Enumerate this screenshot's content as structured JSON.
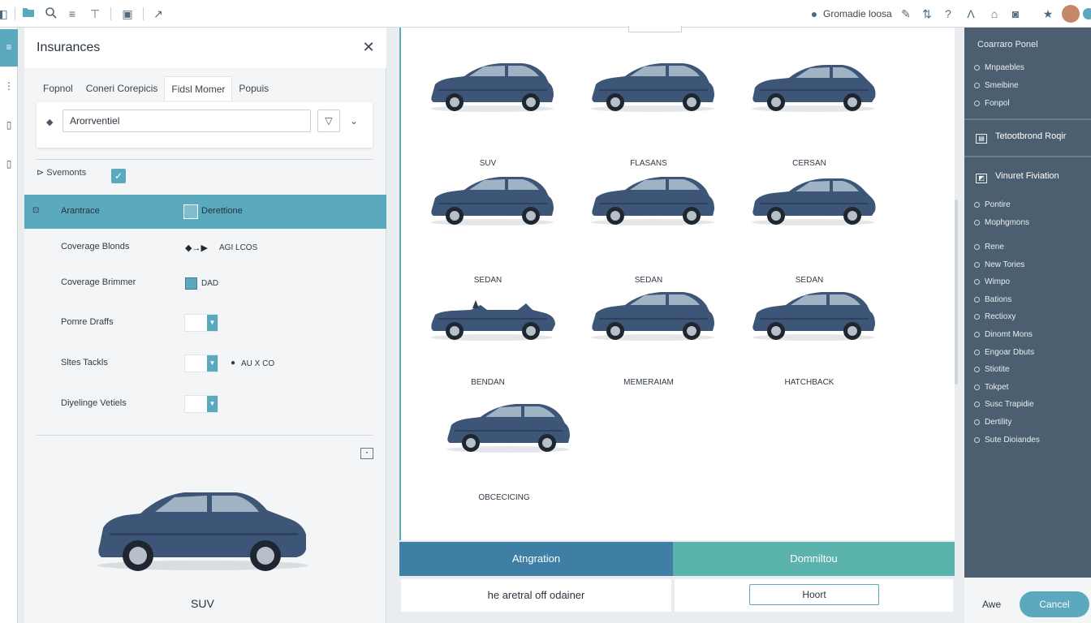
{
  "toolbar": {
    "location_label": "Gromadie loosa",
    "icons": [
      "folder-icon",
      "search-icon",
      "filter-icon",
      "text-icon",
      "image-icon",
      "arrow-icon",
      "globe-icon",
      "tools-icon",
      "help-icon",
      "font-icon",
      "print-icon",
      "camera-icon",
      "star-icon",
      "avatar",
      "settings-icon"
    ]
  },
  "panel": {
    "title": "Insurances",
    "tabs": [
      "Fopnol",
      "Coneri Corepicis",
      "Fidsl Momer",
      "Popuis"
    ],
    "active_tab": 2,
    "search": {
      "value": "Arorrventiel"
    },
    "section": {
      "label": "Svemonts",
      "checked": true
    },
    "highlight": {
      "mark": "⊡",
      "label": "Arantrace",
      "value": "Derettione"
    },
    "fields": [
      {
        "label": "Coverage Blonds",
        "value": "AGI LCOS",
        "control": "arrows"
      },
      {
        "label": "Coverage Brimmer",
        "value": "DAD",
        "control": "swatch"
      },
      {
        "label": "Pomre Draffs",
        "value": "",
        "control": "select"
      },
      {
        "label": "Sltes Tackls",
        "value": "AU X CO",
        "control": "select"
      },
      {
        "label": "Diyelinge Vetiels",
        "value": "",
        "control": "select"
      }
    ],
    "preview_label": "SUV"
  },
  "gallery": {
    "cars": [
      {
        "label": "SUV",
        "type": "hatch"
      },
      {
        "label": "FLASANS",
        "type": "hatch"
      },
      {
        "label": "CERSAN",
        "type": "sedan"
      },
      {
        "label": "SEDAN",
        "type": "hatch"
      },
      {
        "label": "SEDAN",
        "type": "hatch"
      },
      {
        "label": "SEDAN",
        "type": "sedan"
      },
      {
        "label": "BENDAN",
        "type": "convertible"
      },
      {
        "label": "MEMERAIAM",
        "type": "hatch"
      },
      {
        "label": "HATCHBACK",
        "type": "hatch"
      },
      {
        "label": "OBCECICING",
        "type": "hatch"
      }
    ],
    "btn_left": "Atngration",
    "btn_right": "Domniltou",
    "bottom_left_text": "he aretral off odainer",
    "bottom_right_button": "Hoort"
  },
  "rpanel": {
    "title": "Coarraro Ponel",
    "group1": [
      "Mnpaebles",
      "Smeibine",
      "Fonpol"
    ],
    "head1": "Tetootbrond Roqir",
    "head2": "Vinuret Fiviation",
    "group2": [
      "Pontire",
      "Mophgmons"
    ],
    "group3": [
      "Rene",
      "New Tories",
      "Wimpo",
      "Bations",
      "Rectioxy",
      "Dinomt Mons",
      "Engoar Dbuts",
      "Stiotite",
      "Tokpet",
      "Susc Trapidie",
      "Dertility",
      "Sute Dioiandes"
    ]
  },
  "footer": {
    "link": "Awe",
    "cancel": "Cancel"
  },
  "colors": {
    "accent": "#5aa9bd",
    "primary_blue": "#3f7fa5",
    "teal": "#5ab3ad",
    "right_panel": "#4c5f70",
    "car_body": "#3d5677"
  }
}
